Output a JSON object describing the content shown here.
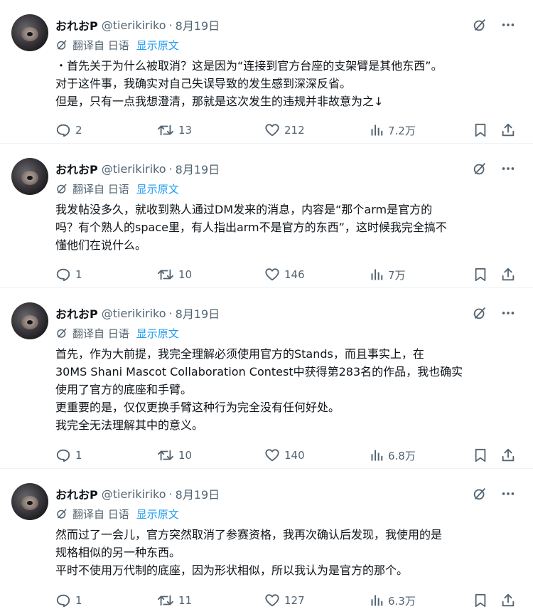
{
  "tweets": [
    {
      "author": "おれおP",
      "handle": "@tierikiriko",
      "sep": "·",
      "date": "8月19日",
      "translated_from": "翻译自 日语",
      "show_original": "显示原文",
      "lines": [
        "・首先关于为什么被取消？这是因为“连接到官方台座的支架臂是其他东西”。",
        "对于这件事，我确实对自己失误导致的发生感到深深反省。",
        "但是，只有一点我想澄清，那就是这次发生的违规并非故意为之↓"
      ],
      "replies": "2",
      "reposts": "13",
      "likes": "212",
      "views": "7.2万"
    },
    {
      "author": "おれおP",
      "handle": "@tierikiriko",
      "sep": "·",
      "date": "8月19日",
      "translated_from": "翻译自 日语",
      "show_original": "显示原文",
      "lines": [
        "我发帖没多久，就收到熟人通过DM发来的消息，内容是“那个arm是官方的",
        "吗？有个熟人的space里，有人指出arm不是官方的东西”，这时候我完全搞不",
        "懂他们在说什么。"
      ],
      "replies": "1",
      "reposts": "10",
      "likes": "146",
      "views": "7万"
    },
    {
      "author": "おれおP",
      "handle": "@tierikiriko",
      "sep": "·",
      "date": "8月19日",
      "translated_from": "翻译自 日语",
      "show_original": "显示原文",
      "lines": [
        "首先，作为大前提，我完全理解必须使用官方的Stands，而且事实上，在",
        "30MS Shani Mascot Collaboration Contest中获得第283名的作品，我也确实",
        "使用了官方的底座和手臂。",
        "更重要的是，仅仅更换手臂这种行为完全没有任何好处。",
        "我完全无法理解其中的意义。"
      ],
      "replies": "1",
      "reposts": "10",
      "likes": "140",
      "views": "6.8万"
    },
    {
      "author": "おれおP",
      "handle": "@tierikiriko",
      "sep": "·",
      "date": "8月19日",
      "translated_from": "翻译自 日语",
      "show_original": "显示原文",
      "lines": [
        "然而过了一会儿，官方突然取消了参赛资格，我再次确认后发现，我使用的是",
        "规格相似的另一种东西。",
        "平时不使用万代制的底座，因为形状相似，所以我认为是官方的那个。"
      ],
      "replies": "1",
      "reposts": "11",
      "likes": "127",
      "views": "6.3万"
    }
  ],
  "icons": {
    "grok": "grok-icon",
    "more": "more-icon",
    "translate": "translate-icon",
    "reply": "reply-icon",
    "repost": "repost-icon",
    "like": "like-icon",
    "views": "views-icon",
    "bookmark": "bookmark-icon",
    "share": "share-icon"
  },
  "colors": {
    "text": "#0f1419",
    "secondary": "#536471",
    "link": "#1d9bf0",
    "divider": "#eff3f4"
  }
}
